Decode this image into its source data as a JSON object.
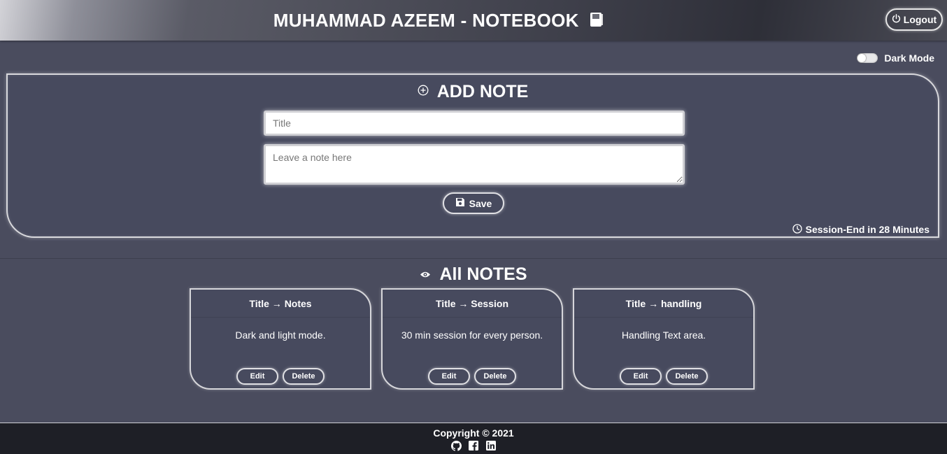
{
  "header": {
    "title": "MUHAMMAD AZEEM - NOTEBOOK",
    "logout_label": "Logout"
  },
  "dark_mode": {
    "label": "Dark Mode",
    "enabled": false
  },
  "add_note": {
    "heading": "ADD NOTE",
    "title_placeholder": "Title",
    "note_placeholder": "Leave a note here",
    "save_label": "Save",
    "session_text": "Session-End in 28 Minutes"
  },
  "all_notes": {
    "heading": "All NOTES",
    "notes": [
      {
        "title": "Title → Notes",
        "body": "Dark and light mode.",
        "edit": "Edit",
        "delete": "Delete"
      },
      {
        "title": "Title → Session",
        "body": "30 min session for every person.",
        "edit": "Edit",
        "delete": "Delete"
      },
      {
        "title": "Title → handling",
        "body": "Handling Text area.",
        "edit": "Edit",
        "delete": "Delete"
      }
    ]
  },
  "footer": {
    "copyright": "Copyright © 2021",
    "social_icons": [
      "github-icon",
      "facebook-icon",
      "linkedin-icon"
    ]
  },
  "colors": {
    "page_bg": "#4a4c5e",
    "panel_bg": "#474a5e",
    "footer_bg": "#1e1f26",
    "text": "#ffffff"
  }
}
